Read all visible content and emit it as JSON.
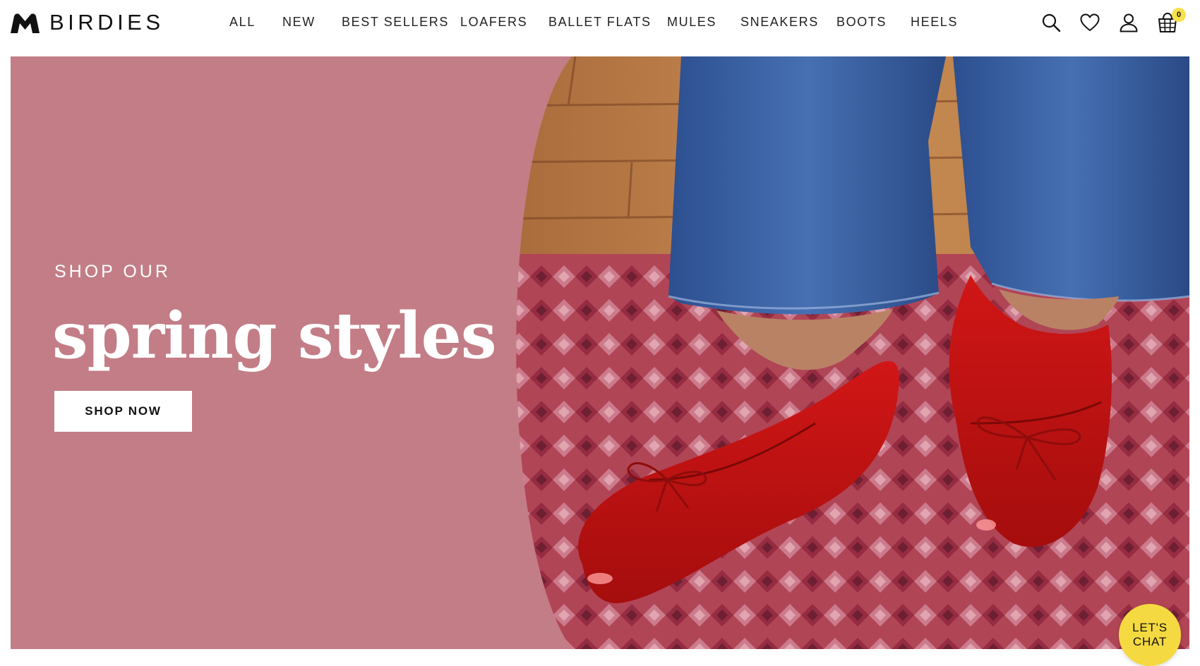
{
  "brand": {
    "name": "BIRDIES",
    "logo_icon": "birdies-logo-icon"
  },
  "nav": {
    "items": [
      {
        "label": "ALL"
      },
      {
        "label": "NEW"
      },
      {
        "label": "BEST SELLERS"
      },
      {
        "label": "LOAFERS"
      },
      {
        "label": "BALLET FLATS"
      },
      {
        "label": "MULES"
      },
      {
        "label": "SNEAKERS"
      },
      {
        "label": "BOOTS"
      },
      {
        "label": "HEELS"
      }
    ]
  },
  "header_icons": {
    "search": "search-icon",
    "wishlist": "heart-icon",
    "account": "user-icon",
    "cart": "shopping-basket-icon",
    "cart_count": "0"
  },
  "hero": {
    "eyebrow": "SHOP OUR",
    "headline": "spring styles",
    "cta_label": "SHOP NOW",
    "image_subject": "red patent ballet flats with bows, blue jeans, patterned red rug, wood floor"
  },
  "chat": {
    "label": "LET'S CHAT"
  },
  "colors": {
    "hero_panel": "#c37d86",
    "chat_bubble": "#f4d940",
    "cart_badge": "#f7e04b",
    "text_dark": "#111111",
    "white": "#ffffff"
  }
}
